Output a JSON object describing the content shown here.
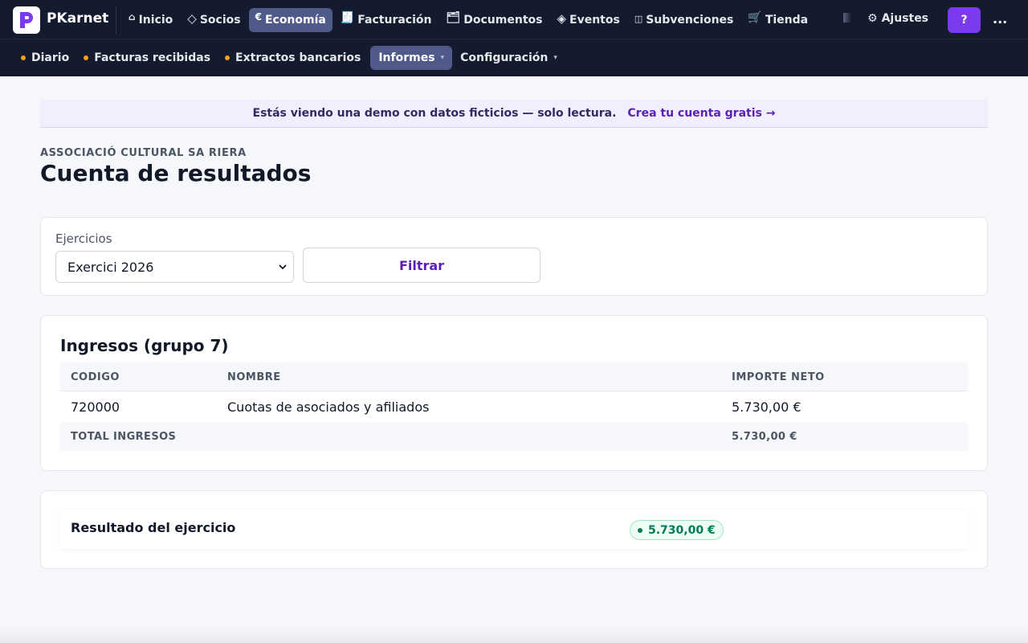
{
  "app": {
    "brand": "PKarnet",
    "logo_letter": "P"
  },
  "topnav": {
    "items": [
      {
        "label": "Inicio",
        "icon": "home-icon",
        "glyph": "⌂"
      },
      {
        "label": "Socios",
        "icon": "diamond-icon",
        "glyph": "◇"
      },
      {
        "label": "Economía",
        "icon": "euro-icon",
        "glyph": "€"
      },
      {
        "label": "Facturación",
        "icon": "receipt-icon",
        "glyph": "🧾"
      },
      {
        "label": "Documentos",
        "icon": "folder-icon",
        "glyph": "🗂"
      },
      {
        "label": "Eventos",
        "icon": "event-diamond-icon",
        "glyph": "◈"
      },
      {
        "label": "Subvenciones",
        "icon": "columns-icon",
        "glyph": "◫"
      },
      {
        "label": "Tienda",
        "icon": "cart-icon",
        "glyph": "🛒"
      }
    ],
    "settings_label": "Ajustes",
    "settings_glyph": "⚙",
    "help_label": "?",
    "more_label": "..."
  },
  "subnav": {
    "items": [
      {
        "label": "Diario"
      },
      {
        "label": "Facturas recibidas"
      },
      {
        "label": "Extractos bancarios"
      },
      {
        "label": "Informes"
      },
      {
        "label": "Configuración"
      }
    ],
    "caret": "▾"
  },
  "banner": {
    "message": "Estás viendo una demo con datos ficticios — solo lectura.",
    "cta": "Crea tu cuenta gratis →"
  },
  "page": {
    "organization": "ASSOCIACIÓ CULTURAL SA RIERA",
    "title": "Cuenta de resultados"
  },
  "filter": {
    "label": "Ejercicios",
    "selected": "Exercici 2026",
    "button": "Filtrar"
  },
  "income": {
    "title": "Ingresos (grupo 7)",
    "columns": [
      "CODIGO",
      "NOMBRE",
      "IMPORTE NETO"
    ],
    "rows": [
      {
        "code": "720000",
        "name": "Cuotas de asociados y afiliados",
        "amount": "5.730,00 €"
      }
    ],
    "total_label": "TOTAL INGRESOS",
    "total_amount": "5.730,00 €"
  },
  "result": {
    "label": "Resultado del ejercicio",
    "amount": "5.730,00 €"
  },
  "colors": {
    "nav_bg": "#151b2e",
    "nav_active": "#4f5a8a",
    "accent": "#7c3aed",
    "link": "#5b21b6",
    "dot": "#f59e0b",
    "positive": "#047857"
  }
}
